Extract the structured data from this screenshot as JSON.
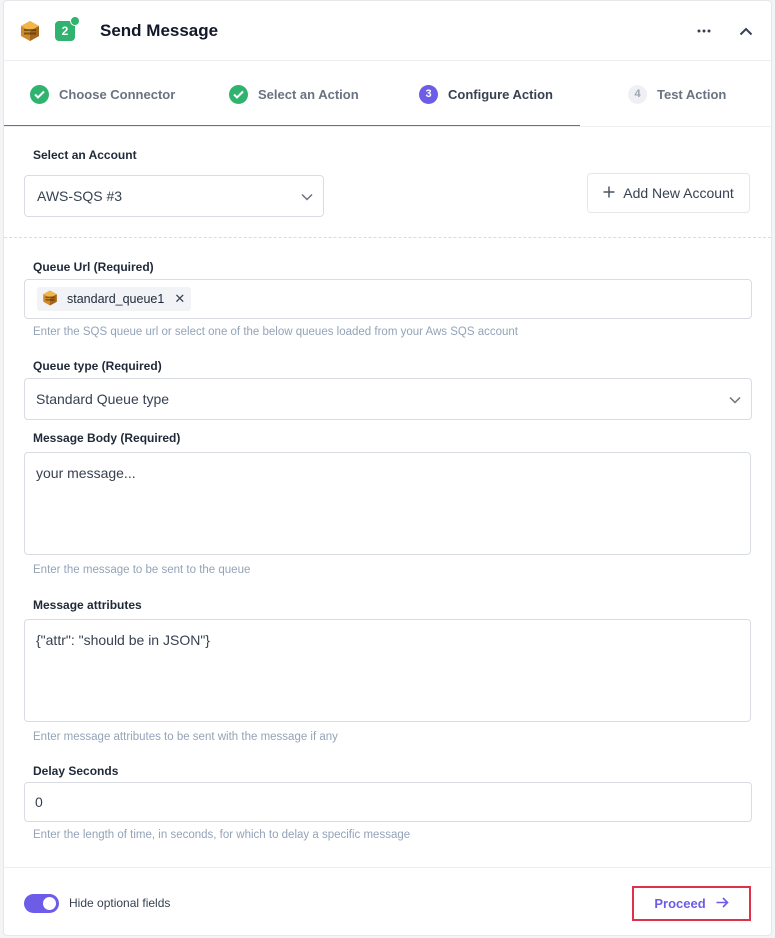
{
  "header": {
    "title": "Send Message",
    "step_number": "2"
  },
  "steps": [
    {
      "number": "1",
      "label": "Choose Connector",
      "state": "done"
    },
    {
      "number": "2",
      "label": "Select an Action",
      "state": "done"
    },
    {
      "number": "3",
      "label": "Configure Action",
      "state": "active"
    },
    {
      "number": "4",
      "label": "Test Action",
      "state": "pending"
    }
  ],
  "account": {
    "label": "Select an Account",
    "value": "AWS-SQS #3",
    "add_button": "Add New Account"
  },
  "queue_url": {
    "label": "Queue Url (Required)",
    "chip": "standard_queue1",
    "help": "Enter the SQS queue url or select one of the below queues loaded from your Aws SQS account"
  },
  "queue_type": {
    "label": "Queue type (Required)",
    "value": "Standard Queue type"
  },
  "message_body": {
    "label": "Message Body (Required)",
    "value": "your message...",
    "help": "Enter the message to be sent to the queue"
  },
  "message_attributes": {
    "label": "Message attributes",
    "value": "{\"attr\": \"should be in JSON\"}",
    "help": "Enter message attributes to be sent with the message if any"
  },
  "delay_seconds": {
    "label": "Delay Seconds",
    "value": "0",
    "help": "Enter the length of time, in seconds, for which to delay a specific message"
  },
  "footer": {
    "toggle_label": "Hide optional fields",
    "toggle_on": true,
    "proceed": "Proceed"
  },
  "colors": {
    "accent": "#6d5ce7",
    "success": "#2fb36f",
    "highlight": "#e0314b"
  }
}
